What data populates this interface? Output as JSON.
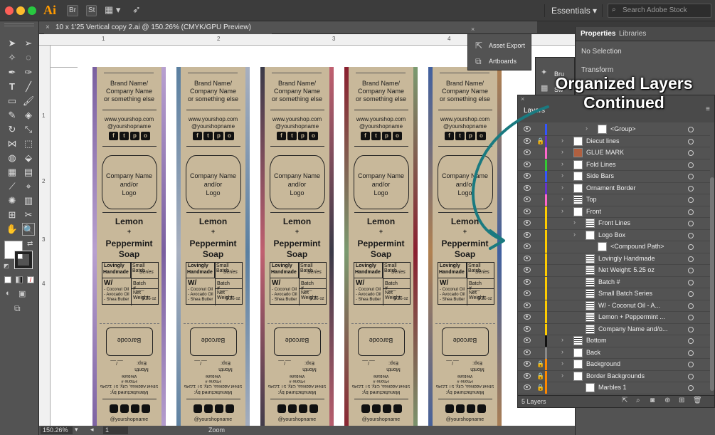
{
  "app": {
    "logo_text": "Ai",
    "bridge_label": "Br",
    "stock_label": "St",
    "workspace": "Essentials",
    "search_placeholder": "Search Adobe Stock"
  },
  "document": {
    "tab_title": "10 x 1'25 Vertical copy 2.ai @ 150.26% (CMYK/GPU Preview)",
    "zoom": "150.26%",
    "artboard": "1",
    "status_label": "Zoom"
  },
  "ruler": {
    "h_ticks": [
      "1",
      "2",
      "3",
      "4"
    ],
    "v_ticks": [
      "1",
      "2",
      "3",
      "4"
    ]
  },
  "label": {
    "brand_line1": "Brand Name/",
    "brand_line2": "Company Name",
    "brand_line3": "or something else",
    "url": "www.yourshop.com",
    "handle": "@yourshopname",
    "social_icons": [
      "f",
      "t",
      "p",
      "o"
    ],
    "logo_line1": "Company Name",
    "logo_line2": "and/or",
    "logo_line3": "Logo",
    "product_line1": "Lemon",
    "product_plus": "+",
    "product_line2": "Peppermint",
    "product_line3": "Soap",
    "lovingly": "Lovingly",
    "handmade": "Handmade",
    "small_batch": "Small Batch",
    "series": "Series",
    "with_label": "W/",
    "ingredient1": "- Coconut Oil",
    "ingredient2": "- Avocado Oil",
    "ingredient3": "- Shea Butter",
    "batch": "Batch #___",
    "net_weight": "Net Weight:",
    "net_weight_val": "5.25 oz",
    "barcode": "Barcode",
    "exp_month": "Month",
    "exp_label": "Exp:",
    "exp_fill": "__/__",
    "manufactured": "Manufactured by:",
    "address": "Street Address, City, ST 12345",
    "phone": "Phone #",
    "website": "Website",
    "bottom_handle": "@yourshopname"
  },
  "label_edge_colors": [
    [
      "#7a5fa0",
      "#b8a0d0"
    ],
    [
      "#5a7fa0",
      "#a8b0c0"
    ],
    [
      "#3a3a48",
      "#c06070"
    ],
    [
      "#8a2030",
      "#7a9a70"
    ],
    [
      "#4060a0",
      "#b08050"
    ]
  ],
  "floating_panel": {
    "asset_export": "Asset Export",
    "artboards": "Artboards"
  },
  "properties": {
    "tab_properties": "Properties",
    "tab_libraries": "Libraries",
    "no_selection": "No Selection",
    "transform": "Transform"
  },
  "mini_panel": {
    "item1": "Bru",
    "item2": "Sw"
  },
  "layers": {
    "title": "Layers",
    "footer_count": "5 Layers",
    "rows": [
      {
        "name": "<Group>",
        "indent": 2,
        "color": "#3355ff",
        "lock": false,
        "chevron": true,
        "thumb": "white"
      },
      {
        "name": "Diecut lines",
        "indent": 0,
        "color": "#6633cc",
        "lock": true,
        "chevron": true,
        "thumb": "white"
      },
      {
        "name": "GLUE MARK",
        "indent": 0,
        "color": "#ff66cc",
        "lock": false,
        "chevron": true,
        "thumb": "#b06040"
      },
      {
        "name": "Fold Lines",
        "indent": 0,
        "color": "#33cc33",
        "lock": false,
        "chevron": true,
        "thumb": "white"
      },
      {
        "name": "Side Bars",
        "indent": 0,
        "color": "#3355ff",
        "lock": false,
        "chevron": true,
        "thumb": "white"
      },
      {
        "name": "Ornament Border",
        "indent": 0,
        "color": "#6633cc",
        "lock": false,
        "chevron": true,
        "thumb": "white"
      },
      {
        "name": "Top",
        "indent": 0,
        "color": "#ff66cc",
        "lock": false,
        "chevron": true,
        "thumb": "pattern"
      },
      {
        "name": "Front",
        "indent": 0,
        "color": "#ffcc00",
        "lock": false,
        "chevron": true,
        "thumb": "white"
      },
      {
        "name": "Front Lines",
        "indent": 1,
        "color": "#ffcc00",
        "lock": false,
        "chevron": true,
        "thumb": "pattern"
      },
      {
        "name": "Logo Box",
        "indent": 1,
        "color": "#ffcc00",
        "lock": false,
        "chevron": true,
        "thumb": "white"
      },
      {
        "name": "<Compound Path>",
        "indent": 2,
        "color": "#ffcc00",
        "lock": false,
        "chevron": false,
        "thumb": "white"
      },
      {
        "name": "Lovingly Handmade",
        "indent": 1,
        "color": "#ffcc00",
        "lock": false,
        "chevron": false,
        "thumb": "pattern"
      },
      {
        "name": "Net Weight: 5.25 oz",
        "indent": 1,
        "color": "#ffcc00",
        "lock": false,
        "chevron": false,
        "thumb": "pattern"
      },
      {
        "name": "Batch #",
        "indent": 1,
        "color": "#ffcc00",
        "lock": false,
        "chevron": false,
        "thumb": "pattern"
      },
      {
        "name": "Small Batch Series",
        "indent": 1,
        "color": "#ffcc00",
        "lock": false,
        "chevron": false,
        "thumb": "pattern"
      },
      {
        "name": "W/  - Coconut Oil - A...",
        "indent": 1,
        "color": "#ffcc00",
        "lock": false,
        "chevron": false,
        "thumb": "pattern"
      },
      {
        "name": "Lemon + Peppermint ...",
        "indent": 1,
        "color": "#ffcc00",
        "lock": false,
        "chevron": false,
        "thumb": "pattern"
      },
      {
        "name": "Company Name and/o...",
        "indent": 1,
        "color": "#ffcc00",
        "lock": false,
        "chevron": false,
        "thumb": "pattern"
      },
      {
        "name": "Bottom",
        "indent": 0,
        "color": "#111111",
        "lock": false,
        "chevron": true,
        "thumb": "pattern"
      },
      {
        "name": "Back",
        "indent": 0,
        "color": "#888888",
        "lock": false,
        "chevron": true,
        "thumb": "white"
      },
      {
        "name": "Background",
        "indent": 0,
        "color": "#ff8800",
        "lock": true,
        "chevron": true,
        "thumb": "white"
      },
      {
        "name": "Border Backgrounds",
        "indent": 0,
        "color": "#ff8800",
        "lock": true,
        "chevron": true,
        "thumb": "white"
      },
      {
        "name": "Marbles 1",
        "indent": 1,
        "color": "#ff8800",
        "lock": true,
        "chevron": false,
        "thumb": "white"
      }
    ]
  },
  "overlay": {
    "line1": "Organized Layers",
    "line2": "Continued"
  },
  "colors": {
    "arrow": "#1a7a80",
    "label_bg": "#c8b89a"
  }
}
